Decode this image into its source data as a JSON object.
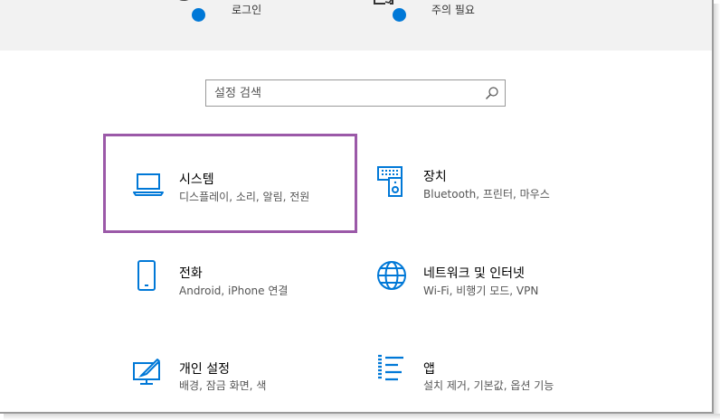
{
  "top_bar": {
    "items": [
      {
        "label": "로그인",
        "icon": "account-sync-icon"
      },
      {
        "label": "주의 필요",
        "icon": "update-device-icon"
      }
    ]
  },
  "search": {
    "placeholder": "설정 검색",
    "value": ""
  },
  "tiles": [
    {
      "key": "system",
      "title": "시스템",
      "description": "디스플레이, 소리, 알림, 전원",
      "icon": "laptop-icon",
      "selected": true
    },
    {
      "key": "devices",
      "title": "장치",
      "description": "Bluetooth, 프린터, 마우스",
      "icon": "keyboard-speaker-icon"
    },
    {
      "key": "phone",
      "title": "전화",
      "description": "Android, iPhone 연결",
      "icon": "phone-icon"
    },
    {
      "key": "network",
      "title": "네트워크 및 인터넷",
      "description": "Wi-Fi, 비행기 모드, VPN",
      "icon": "globe-icon"
    },
    {
      "key": "personalization",
      "title": "개인 설정",
      "description": "배경, 잠금 화면, 색",
      "icon": "paint-screen-icon"
    },
    {
      "key": "apps",
      "title": "앱",
      "description": "설치 제거, 기본값, 옵션 기능",
      "icon": "apps-list-icon"
    }
  ],
  "colors": {
    "accent": "#0078d7",
    "selection_border": "#9b59a8",
    "top_strip": "#f2f2f2"
  }
}
